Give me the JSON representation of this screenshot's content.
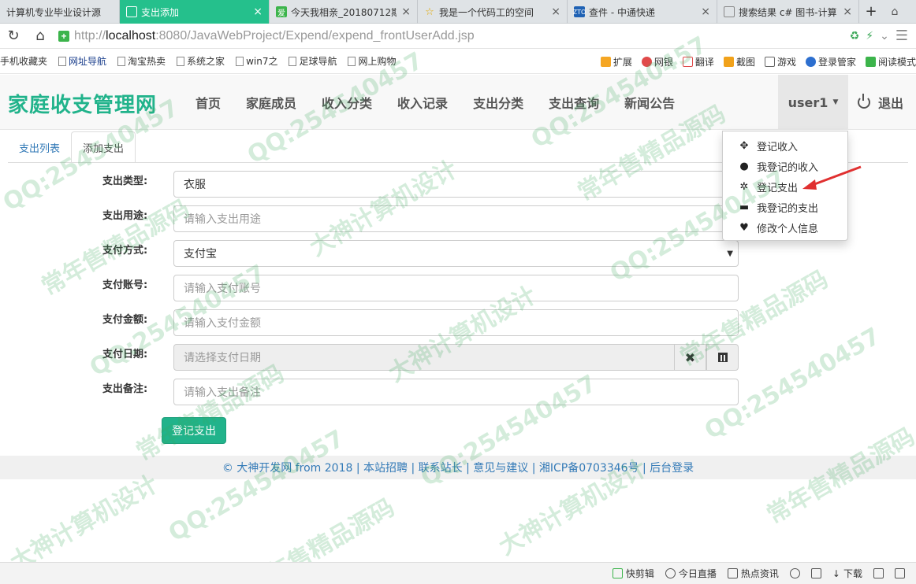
{
  "browser": {
    "tabs": [
      {
        "label": "计算机专业毕业设计源",
        "icon_color": "#4a86c5",
        "active": false
      },
      {
        "label": "支出添加",
        "icon_color": "#ffffff",
        "active": true
      },
      {
        "label": "今天我相亲_20180712期",
        "icon_color": "#3cb44b",
        "active": false
      },
      {
        "label": "我是一个代码工的空间",
        "icon_color": "#f1c232",
        "active": false
      },
      {
        "label": "查件 - 中通快递",
        "icon_color": "#1f62b4",
        "active": false
      },
      {
        "label": "搜索结果 c# 图书-计算",
        "icon_color": "#888888",
        "active": false
      }
    ],
    "url_prefix": "http://",
    "url_host": "localhost",
    "url_path": ":8080/JavaWebProject/Expend/expend_frontUserAdd.jsp",
    "bookmarks": [
      "手机收藏夹",
      "网址导航",
      "淘宝热卖",
      "系统之家",
      "win7之",
      "足球导航",
      "网上购物"
    ],
    "bookmarks_right": [
      "扩展",
      "网银",
      "翻译",
      "截图",
      "游戏",
      "登录管家",
      "阅读模式"
    ]
  },
  "navbar": {
    "brand": "家庭收支管理网",
    "links": [
      "首页",
      "家庭成员",
      "收入分类",
      "收入记录",
      "支出分类",
      "支出查询",
      "新闻公告"
    ],
    "user": "user1",
    "logout": "退出"
  },
  "dropdown": {
    "items": [
      {
        "label": "登记收入",
        "icon": "move-icon"
      },
      {
        "label": "我登记的收入",
        "icon": "user-icon"
      },
      {
        "label": "登记支出",
        "icon": "gear-icon"
      },
      {
        "label": "我登记的支出",
        "icon": "credit-card-icon"
      },
      {
        "label": "修改个人信息",
        "icon": "heart-icon"
      }
    ]
  },
  "subtabs": [
    "支出列表",
    "添加支出"
  ],
  "form": {
    "type_label": "支出类型:",
    "type_value": "衣服",
    "purpose_label": "支出用途:",
    "purpose_placeholder": "请输入支出用途",
    "paymethod_label": "支付方式:",
    "paymethod_value": "支付宝",
    "account_label": "支付账号:",
    "account_placeholder": "请输入支付账号",
    "amount_label": "支付金额:",
    "amount_placeholder": "请输入支付金额",
    "date_label": "支付日期:",
    "date_placeholder": "请选择支付日期",
    "memo_label": "支出备注:",
    "memo_placeholder": "请输入支出备注",
    "submit": "登记支出"
  },
  "footer": "© 大神开发网 from 2018 | 本站招聘 | 联系站长 | 意见与建议 | 湘ICP备0703346号 | 后台登录",
  "watermarks": [
    "QQ:254540457",
    "常年售精品源码",
    "大神计算机设计"
  ],
  "statusbar": [
    "快剪辑",
    "今日直播",
    "热点资讯",
    "下载"
  ],
  "colors": {
    "accent": "#21b38b",
    "active_tab": "#25c08c",
    "link": "#337ab7",
    "annotation": "#e03030"
  }
}
